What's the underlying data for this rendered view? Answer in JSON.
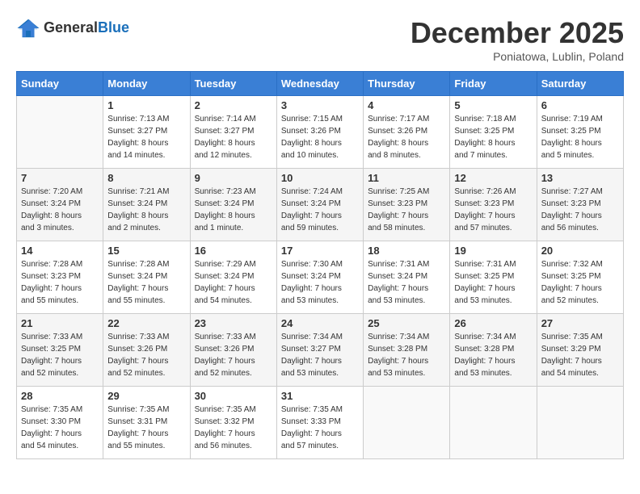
{
  "header": {
    "logo_line1": "General",
    "logo_line2": "Blue",
    "month_title": "December 2025",
    "subtitle": "Poniatowa, Lublin, Poland"
  },
  "days_of_week": [
    "Sunday",
    "Monday",
    "Tuesday",
    "Wednesday",
    "Thursday",
    "Friday",
    "Saturday"
  ],
  "weeks": [
    [
      {
        "day": "",
        "info": ""
      },
      {
        "day": "1",
        "info": "Sunrise: 7:13 AM\nSunset: 3:27 PM\nDaylight: 8 hours\nand 14 minutes."
      },
      {
        "day": "2",
        "info": "Sunrise: 7:14 AM\nSunset: 3:27 PM\nDaylight: 8 hours\nand 12 minutes."
      },
      {
        "day": "3",
        "info": "Sunrise: 7:15 AM\nSunset: 3:26 PM\nDaylight: 8 hours\nand 10 minutes."
      },
      {
        "day": "4",
        "info": "Sunrise: 7:17 AM\nSunset: 3:26 PM\nDaylight: 8 hours\nand 8 minutes."
      },
      {
        "day": "5",
        "info": "Sunrise: 7:18 AM\nSunset: 3:25 PM\nDaylight: 8 hours\nand 7 minutes."
      },
      {
        "day": "6",
        "info": "Sunrise: 7:19 AM\nSunset: 3:25 PM\nDaylight: 8 hours\nand 5 minutes."
      }
    ],
    [
      {
        "day": "7",
        "info": "Sunrise: 7:20 AM\nSunset: 3:24 PM\nDaylight: 8 hours\nand 3 minutes."
      },
      {
        "day": "8",
        "info": "Sunrise: 7:21 AM\nSunset: 3:24 PM\nDaylight: 8 hours\nand 2 minutes."
      },
      {
        "day": "9",
        "info": "Sunrise: 7:23 AM\nSunset: 3:24 PM\nDaylight: 8 hours\nand 1 minute."
      },
      {
        "day": "10",
        "info": "Sunrise: 7:24 AM\nSunset: 3:24 PM\nDaylight: 7 hours\nand 59 minutes."
      },
      {
        "day": "11",
        "info": "Sunrise: 7:25 AM\nSunset: 3:23 PM\nDaylight: 7 hours\nand 58 minutes."
      },
      {
        "day": "12",
        "info": "Sunrise: 7:26 AM\nSunset: 3:23 PM\nDaylight: 7 hours\nand 57 minutes."
      },
      {
        "day": "13",
        "info": "Sunrise: 7:27 AM\nSunset: 3:23 PM\nDaylight: 7 hours\nand 56 minutes."
      }
    ],
    [
      {
        "day": "14",
        "info": "Sunrise: 7:28 AM\nSunset: 3:23 PM\nDaylight: 7 hours\nand 55 minutes."
      },
      {
        "day": "15",
        "info": "Sunrise: 7:28 AM\nSunset: 3:24 PM\nDaylight: 7 hours\nand 55 minutes."
      },
      {
        "day": "16",
        "info": "Sunrise: 7:29 AM\nSunset: 3:24 PM\nDaylight: 7 hours\nand 54 minutes."
      },
      {
        "day": "17",
        "info": "Sunrise: 7:30 AM\nSunset: 3:24 PM\nDaylight: 7 hours\nand 53 minutes."
      },
      {
        "day": "18",
        "info": "Sunrise: 7:31 AM\nSunset: 3:24 PM\nDaylight: 7 hours\nand 53 minutes."
      },
      {
        "day": "19",
        "info": "Sunrise: 7:31 AM\nSunset: 3:25 PM\nDaylight: 7 hours\nand 53 minutes."
      },
      {
        "day": "20",
        "info": "Sunrise: 7:32 AM\nSunset: 3:25 PM\nDaylight: 7 hours\nand 52 minutes."
      }
    ],
    [
      {
        "day": "21",
        "info": "Sunrise: 7:33 AM\nSunset: 3:25 PM\nDaylight: 7 hours\nand 52 minutes."
      },
      {
        "day": "22",
        "info": "Sunrise: 7:33 AM\nSunset: 3:26 PM\nDaylight: 7 hours\nand 52 minutes."
      },
      {
        "day": "23",
        "info": "Sunrise: 7:33 AM\nSunset: 3:26 PM\nDaylight: 7 hours\nand 52 minutes."
      },
      {
        "day": "24",
        "info": "Sunrise: 7:34 AM\nSunset: 3:27 PM\nDaylight: 7 hours\nand 53 minutes."
      },
      {
        "day": "25",
        "info": "Sunrise: 7:34 AM\nSunset: 3:28 PM\nDaylight: 7 hours\nand 53 minutes."
      },
      {
        "day": "26",
        "info": "Sunrise: 7:34 AM\nSunset: 3:28 PM\nDaylight: 7 hours\nand 53 minutes."
      },
      {
        "day": "27",
        "info": "Sunrise: 7:35 AM\nSunset: 3:29 PM\nDaylight: 7 hours\nand 54 minutes."
      }
    ],
    [
      {
        "day": "28",
        "info": "Sunrise: 7:35 AM\nSunset: 3:30 PM\nDaylight: 7 hours\nand 54 minutes."
      },
      {
        "day": "29",
        "info": "Sunrise: 7:35 AM\nSunset: 3:31 PM\nDaylight: 7 hours\nand 55 minutes."
      },
      {
        "day": "30",
        "info": "Sunrise: 7:35 AM\nSunset: 3:32 PM\nDaylight: 7 hours\nand 56 minutes."
      },
      {
        "day": "31",
        "info": "Sunrise: 7:35 AM\nSunset: 3:33 PM\nDaylight: 7 hours\nand 57 minutes."
      },
      {
        "day": "",
        "info": ""
      },
      {
        "day": "",
        "info": ""
      },
      {
        "day": "",
        "info": ""
      }
    ]
  ]
}
